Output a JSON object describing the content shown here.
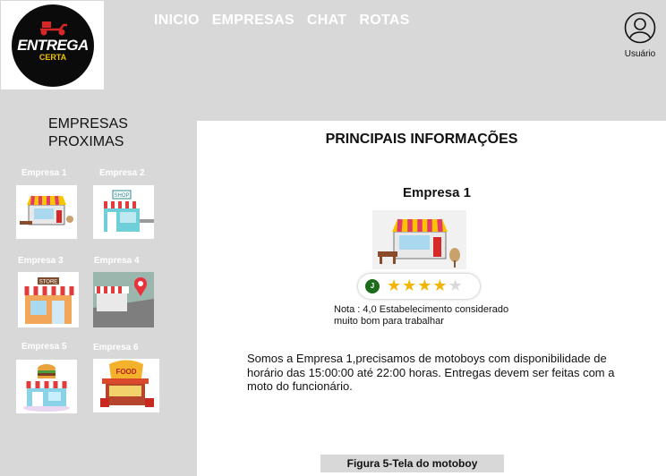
{
  "logo": {
    "title": "ENTREGA",
    "subtitle": "CERTA"
  },
  "nav": {
    "items": [
      "INICIO",
      "EMPRESAS",
      "CHAT",
      "ROTAS"
    ]
  },
  "user": {
    "label": "Usuário"
  },
  "sidebar": {
    "title_line1": "EMPRESAS",
    "title_line2": "PROXIMAS",
    "companies": [
      {
        "label": "Empresa 1",
        "icon": "store-awning-icon"
      },
      {
        "label": "Empresa 2",
        "icon": "shop-icon"
      },
      {
        "label": "Empresa 3",
        "icon": "store-icon"
      },
      {
        "label": "Empresa 4",
        "icon": "store-map-pin-icon"
      },
      {
        "label": "Empresa 5",
        "icon": "burger-shop-icon"
      },
      {
        "label": "Empresa 6",
        "icon": "food-stand-icon"
      }
    ]
  },
  "main": {
    "title": "PRINCIPAIS INFORMAÇÕES",
    "company_name": "Empresa 1",
    "rating": {
      "avatar_initial": "J",
      "stars": 4,
      "max_stars": 5
    },
    "note_line1": "Nota : 4,0 Estabelecimento considerado",
    "note_line2": "muito bom para trabalhar",
    "description": "Somos a Empresa 1,precisamos de  motoboys com disponibilidade de horário das 15:00:00 até 22:00 horas. Entregas devem ser feitas com a moto do funcionário."
  },
  "caption": "Figura 5-Tela do motoboy",
  "colors": {
    "background": "#d8d8d8",
    "panel": "#ffffff",
    "star": "#f4b400",
    "brand_yellow": "#f3c200"
  }
}
